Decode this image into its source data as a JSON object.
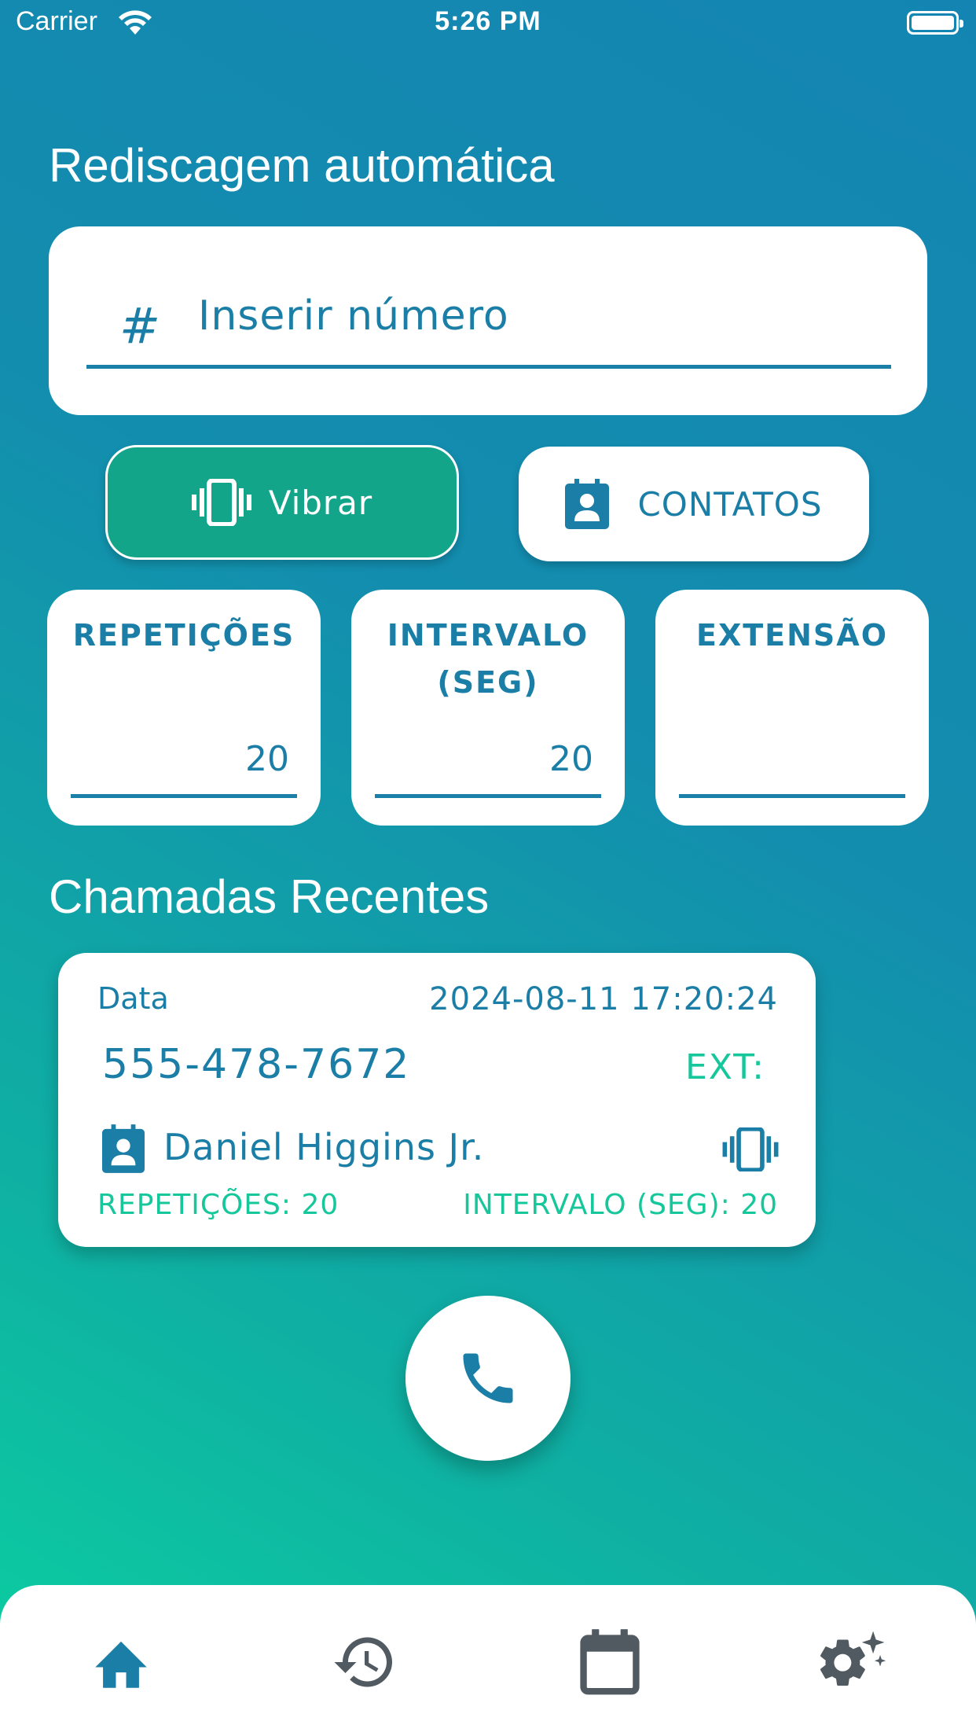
{
  "status_bar": {
    "carrier": "Carrier",
    "time": "5:26 PM"
  },
  "header": {
    "title": "Rediscagem automática"
  },
  "number_input": {
    "hash": "#",
    "placeholder": "Inserir número",
    "value": ""
  },
  "buttons": {
    "vibrate_label": "Vibrar",
    "contacts_label": "CONTATOS"
  },
  "settings": {
    "repetitions": {
      "label": "REPETIÇÕES",
      "value": "20"
    },
    "interval": {
      "label_line1": "INTERVALO",
      "label_line2": "(SEG)",
      "value": "20"
    },
    "extension": {
      "label": "EXTENSÃO",
      "value": ""
    }
  },
  "recent": {
    "title": "Chamadas Recentes",
    "items": [
      {
        "date_label": "Data",
        "datetime": "2024-08-11 17:20:24",
        "number": "555-478-7672",
        "ext_label": "EXT:",
        "contact": "Daniel Higgins Jr.",
        "repetitions": "REPETIÇÕES: 20",
        "interval": "INTERVALO (SEG): 20"
      }
    ]
  },
  "colors": {
    "accent": "#1a7ea6",
    "green": "#13a58a",
    "teal_text": "#15c79a",
    "nav_active": "#1a7ea6",
    "nav_inactive": "#505a60"
  },
  "nav": {
    "items": [
      "home-icon",
      "history-icon",
      "calendar-icon",
      "settings-icon"
    ],
    "active": "home-icon"
  }
}
